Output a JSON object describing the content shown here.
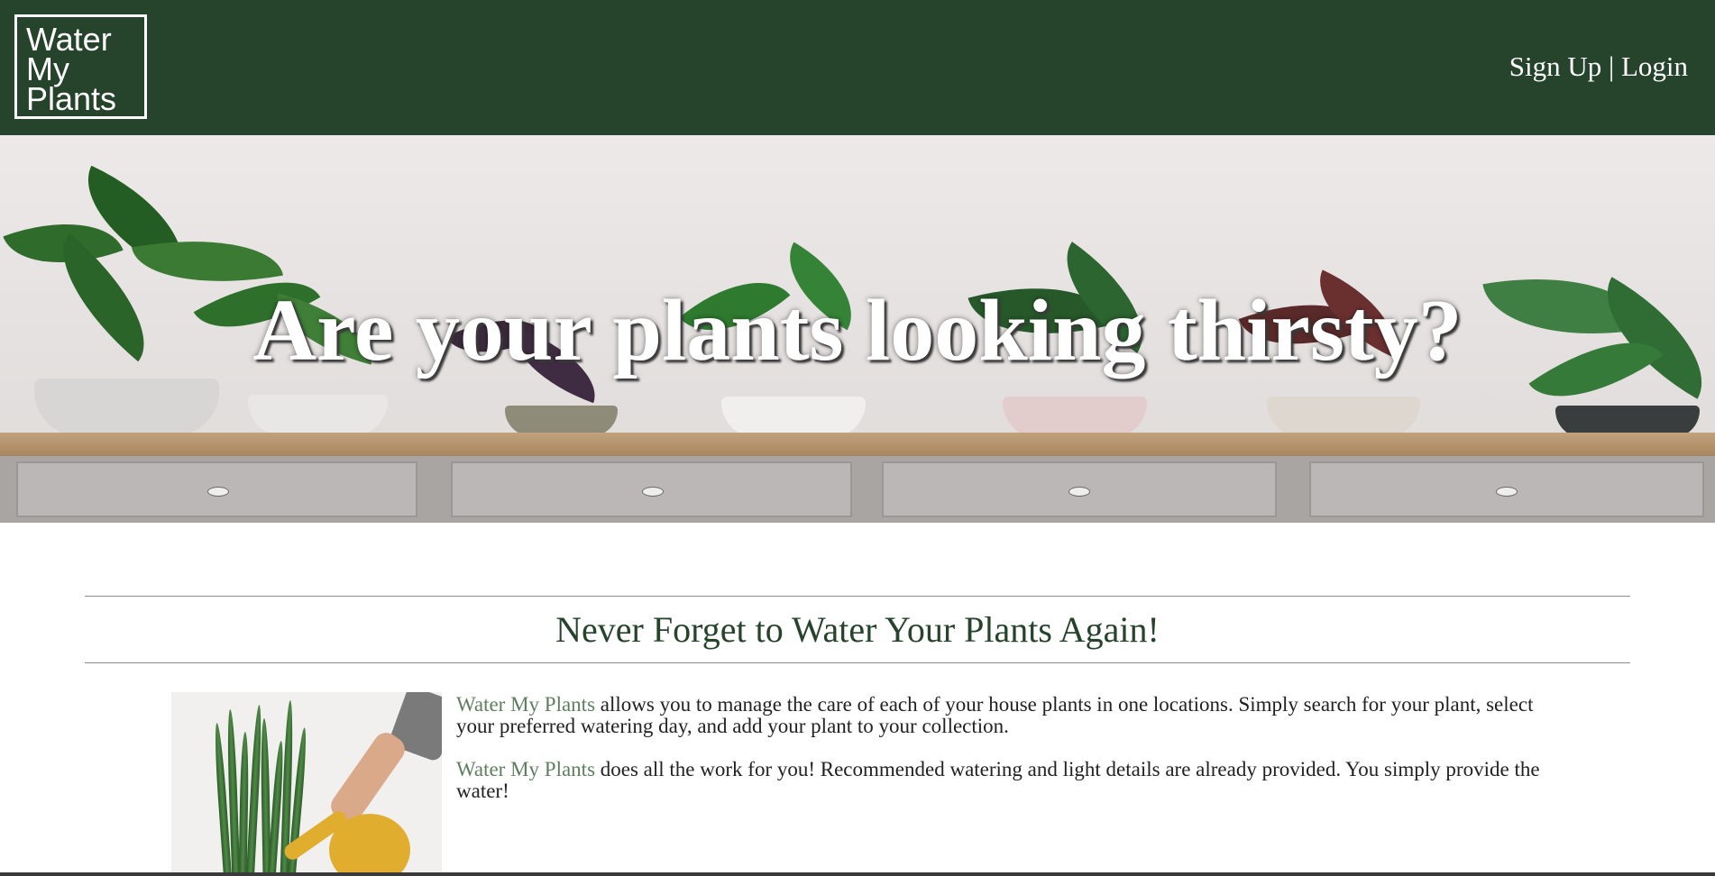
{
  "header": {
    "logo_lines": [
      "Water",
      "My",
      "Plants"
    ],
    "nav": {
      "sign_up": "Sign Up",
      "separator": "|",
      "login": "Login"
    }
  },
  "hero": {
    "title": "Are your plants looking thirsty?"
  },
  "intro": {
    "title": "Never Forget to Water Your Plants Again!",
    "paragraphs": [
      {
        "brand": "Water My Plants",
        "text": " allows you to manage the care of each of your house plants in one locations. Simply search for your plant, select your preferred watering day, and add your plant to your collection."
      },
      {
        "brand": "Water My Plants",
        "text": " does all the work for you! Recommended watering and light details are already provided. You simply provide the water!"
      }
    ]
  },
  "colors": {
    "header_bg": "#26432c",
    "title_green": "#26432c",
    "brand_green": "#5e7f5e"
  }
}
